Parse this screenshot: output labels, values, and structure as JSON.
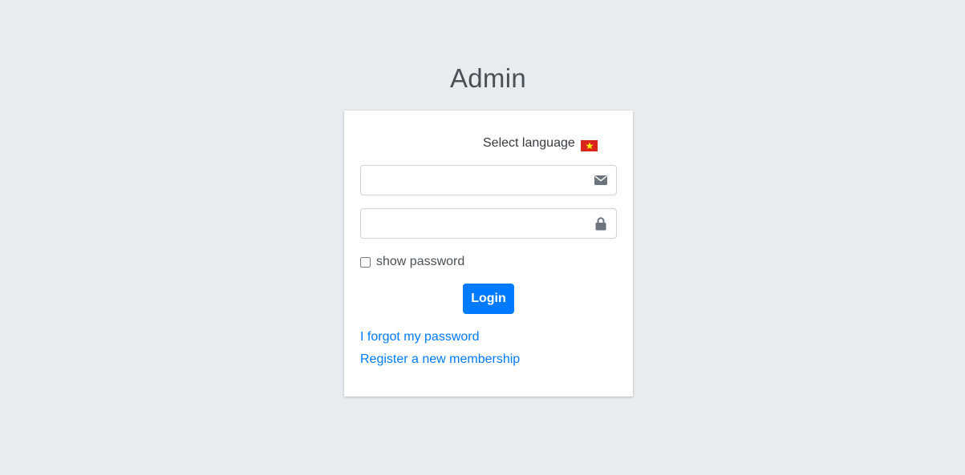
{
  "header": {
    "title": "Admin"
  },
  "language": {
    "label": "Select language",
    "flag_icon": "vietnam-flag-icon",
    "flag_color": "#da251d",
    "star_color": "#ffff00"
  },
  "form": {
    "email": {
      "value": "",
      "placeholder": "",
      "icon": "envelope-icon"
    },
    "password": {
      "value": "",
      "placeholder": "",
      "icon": "lock-icon"
    },
    "show_password_label": "show password",
    "show_password_checked": false,
    "login_label": "Login"
  },
  "links": {
    "forgot_password": "I forgot my password",
    "register": "Register a new membership"
  },
  "colors": {
    "background": "#e9ecef",
    "primary": "#007bff",
    "icon": "#6c757d"
  }
}
